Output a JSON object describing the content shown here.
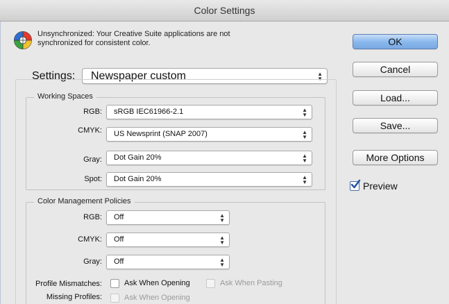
{
  "window": {
    "title": "Color Settings"
  },
  "sync": {
    "line1": "Unsynchronized: Your Creative Suite applications are not",
    "line2": "synchronized for consistent color."
  },
  "settings": {
    "label": "Settings:",
    "value": "Newspaper custom"
  },
  "working_spaces": {
    "title": "Working Spaces",
    "rows": [
      {
        "label": "RGB:",
        "value": "sRGB IEC61966-2.1"
      },
      {
        "label": "CMYK:",
        "value": "US Newsprint (SNAP 2007)"
      },
      {
        "label": "Gray:",
        "value": "Dot Gain 20%"
      },
      {
        "label": "Spot:",
        "value": "Dot Gain 20%"
      }
    ]
  },
  "policies": {
    "title": "Color Management Policies",
    "rows": [
      {
        "label": "RGB:",
        "value": "Off"
      },
      {
        "label": "CMYK:",
        "value": "Off"
      },
      {
        "label": "Gray:",
        "value": "Off"
      }
    ],
    "profile_mismatches": {
      "label": "Profile Mismatches:",
      "ask_opening": {
        "label": "Ask When Opening",
        "checked": false,
        "enabled": true
      },
      "ask_pasting": {
        "label": "Ask When Pasting",
        "checked": false,
        "enabled": false
      }
    },
    "missing_profiles": {
      "label": "Missing Profiles:",
      "ask_opening": {
        "label": "Ask When Opening",
        "checked": false,
        "enabled": false
      }
    }
  },
  "buttons": {
    "ok": "OK",
    "cancel": "Cancel",
    "load": "Load...",
    "save": "Save...",
    "more_options": "More Options"
  },
  "preview": {
    "label": "Preview",
    "checked": true
  },
  "colors": {
    "default_button": "#8ab9ee",
    "checkbox_check": "#1f4fa0"
  }
}
